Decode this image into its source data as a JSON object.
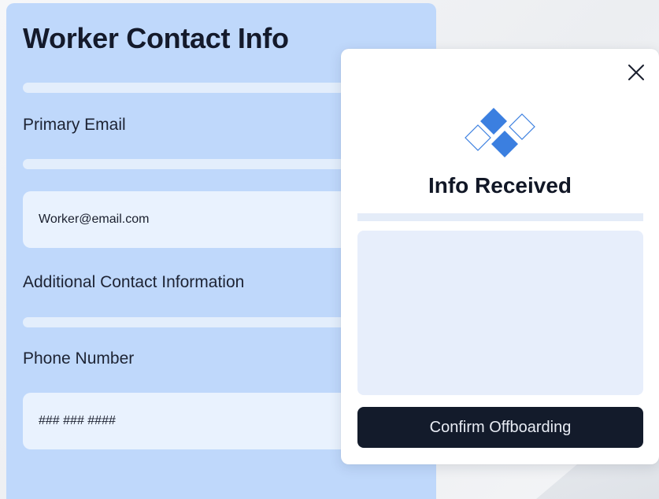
{
  "form": {
    "title": "Worker Contact Info",
    "primary_email_label": "Primary Email",
    "primary_email_value": "Worker@email.com",
    "additional_info_label": "Additional Contact Information",
    "phone_label": "Phone Number",
    "phone_value": "### ### ####"
  },
  "modal": {
    "title": "Info Received",
    "confirm_label": "Confirm Offboarding",
    "close_icon": "close-icon",
    "logo_icon": "diamond-logo-icon"
  },
  "colors": {
    "card_bg": "#bfd8fb",
    "accent": "#3b7fe0",
    "button_bg": "#131b2b"
  }
}
